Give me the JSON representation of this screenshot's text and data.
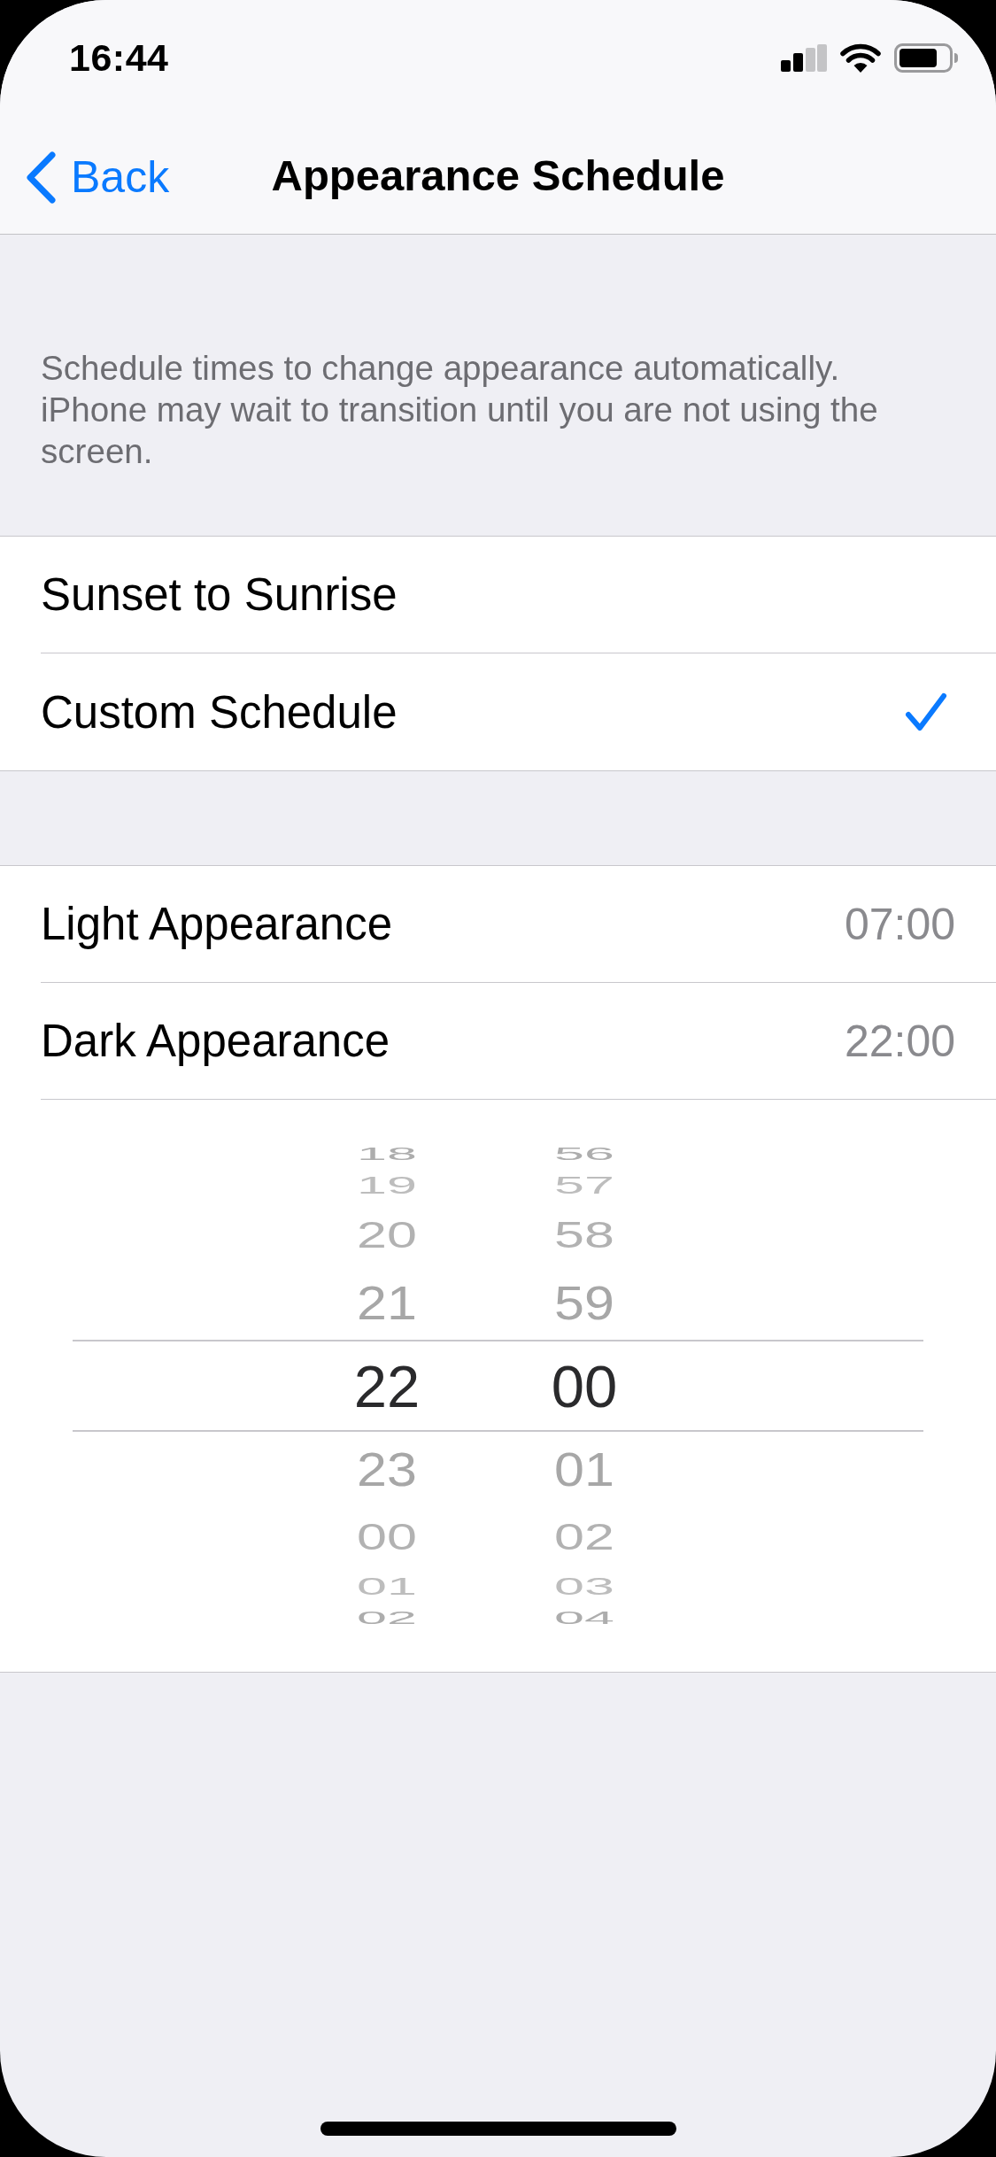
{
  "status_bar": {
    "time": "16:44"
  },
  "nav_bar": {
    "back_label": "Back",
    "title": "Appearance Schedule"
  },
  "description": "Schedule times to change appearance automatically. iPhone may wait to transition until you are not using the screen.",
  "schedule_options": [
    {
      "label": "Sunset to Sunrise",
      "selected": false
    },
    {
      "label": "Custom Schedule",
      "selected": true
    }
  ],
  "times": [
    {
      "label": "Light Appearance",
      "value": "07:00"
    },
    {
      "label": "Dark Appearance",
      "value": "22:00",
      "time_picker": {
        "columns": [
          {
            "items": [
              {
                "label": "18",
                "selected": false
              },
              {
                "label": "19",
                "selected": false
              },
              {
                "label": "20",
                "selected": false
              },
              {
                "label": "21",
                "selected": false
              },
              {
                "label": "22",
                "selected": true
              },
              {
                "label": "23",
                "selected": false
              },
              {
                "label": "00",
                "selected": false
              },
              {
                "label": "01",
                "selected": false
              },
              {
                "label": "02",
                "selected": false
              }
            ]
          },
          {
            "items": [
              {
                "label": "56",
                "selected": false
              },
              {
                "label": "57",
                "selected": false
              },
              {
                "label": "58",
                "selected": false
              },
              {
                "label": "59",
                "selected": false
              },
              {
                "label": "00",
                "selected": true
              },
              {
                "label": "01",
                "selected": false
              },
              {
                "label": "02",
                "selected": false
              },
              {
                "label": "03",
                "selected": false
              },
              {
                "label": "04",
                "selected": false
              }
            ]
          }
        ]
      }
    }
  ]
}
